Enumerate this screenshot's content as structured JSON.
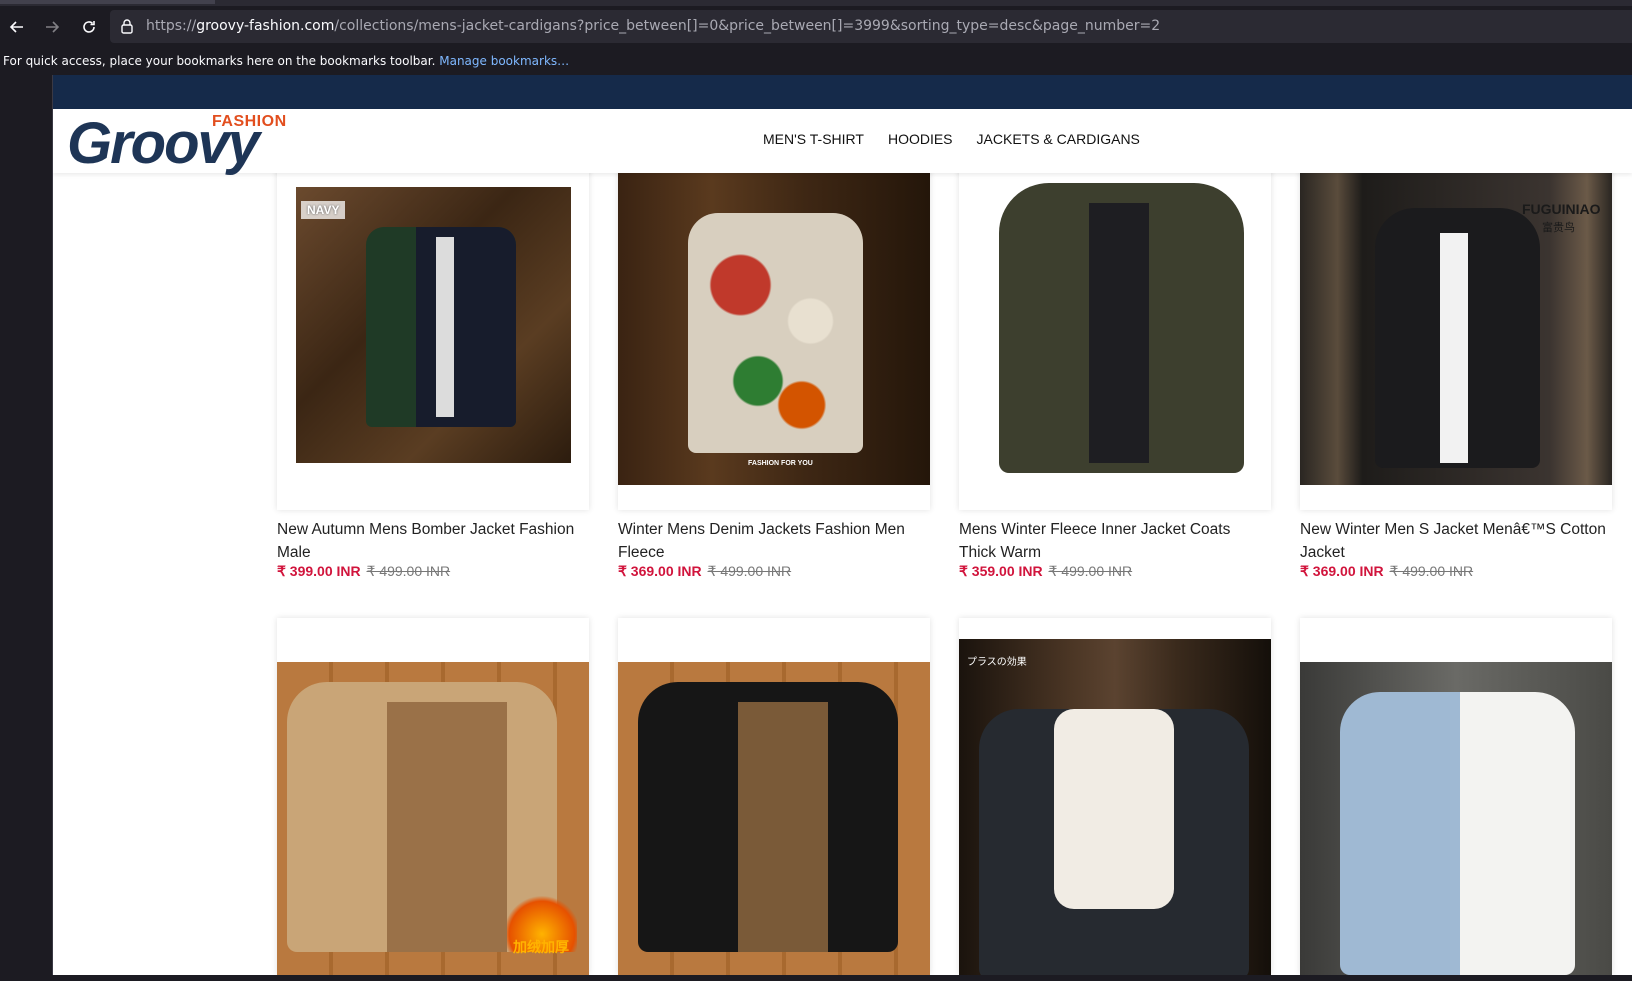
{
  "browser": {
    "url_prefix": "https://",
    "url_host": "groovy-fashion.com",
    "url_path": "/collections/mens-jacket-cardigans?price_between[]=0&price_between[]=3999&sorting_type=desc&page_number=2",
    "bookmarks_text": "For quick access, place your bookmarks here on the bookmarks toolbar.",
    "bookmarks_link": "Manage bookmarks…"
  },
  "site": {
    "logo_word": "Groovy",
    "logo_tag": "FASHION",
    "nav": [
      "MEN'S T-SHIRT",
      "HOODIES",
      "JACKETS & CARDIGANS"
    ],
    "colors": {
      "topbar": "#152a4a",
      "price": "#d1143c",
      "logo_blue": "#1e3556",
      "logo_orange": "#e24e1e"
    }
  },
  "products": [
    {
      "title": "New Autumn Mens Bomber Jacket Fashion Male",
      "price": "₹ 399.00 INR",
      "old_price": "₹ 499.00 INR",
      "badge": "NAVY"
    },
    {
      "title": "Winter Mens Denim Jackets Fashion Men Fleece",
      "price": "₹ 369.00 INR",
      "old_price": "₹ 499.00 INR",
      "img_caption": "FASHION FOR YOU"
    },
    {
      "title": "Mens Winter Fleece Inner Jacket Coats Thick Warm",
      "price": "₹ 359.00 INR",
      "old_price": "₹ 499.00 INR"
    },
    {
      "title": "New Winter Men S Jacket Menâ€™S Cotton Jacket",
      "price": "₹ 369.00 INR",
      "old_price": "₹ 499.00 INR",
      "brand": "FUGUINIAO",
      "brand_sub": "富贵鸟"
    },
    {
      "title": "",
      "price": "",
      "old_price": "",
      "img_text": "加绒加厚"
    },
    {
      "title": "",
      "price": "",
      "old_price": ""
    },
    {
      "title": "",
      "price": "",
      "old_price": "",
      "img_text": "プラスの効果"
    },
    {
      "title": "",
      "price": "",
      "old_price": ""
    }
  ]
}
